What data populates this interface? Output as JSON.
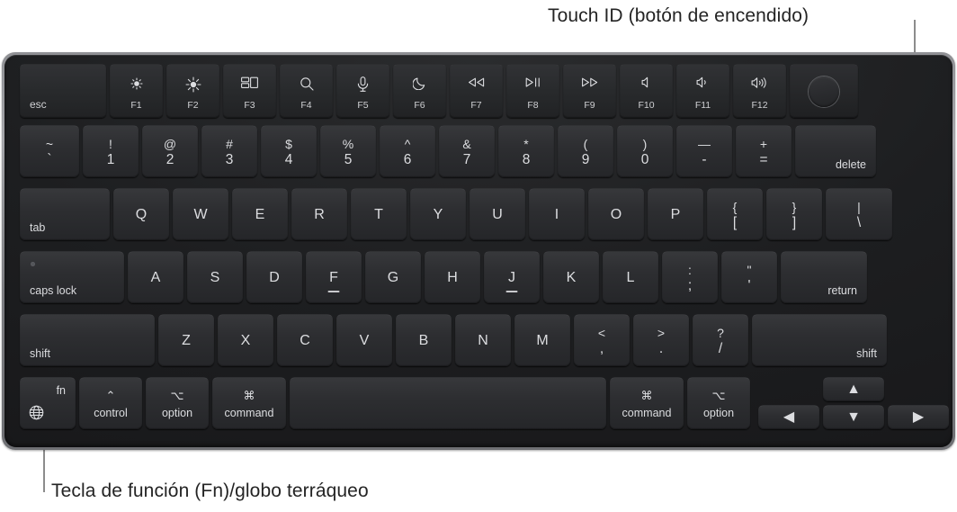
{
  "callouts": [
    {
      "id": "touch-id",
      "text": "Touch ID (botón de encendido)"
    },
    {
      "id": "fn-globe",
      "text": "Tecla de función (Fn)/globo terráqueo"
    }
  ],
  "colors": {
    "page_background": "#ffffff",
    "callout_text": "#242424",
    "leader_line": "#8c8c8c",
    "chassis": "#9a9b9f",
    "keybed": "#1d1e20",
    "key_face": "#2d2e31",
    "key_legend": "#dcdde0"
  },
  "keyboard": {
    "layout": "Apple Magic Keyboard — US ANSI with Touch ID",
    "rows": [
      {
        "name": "function-row",
        "keys": [
          {
            "name": "esc",
            "primary": "esc",
            "align": "corner-left",
            "icon": null
          },
          {
            "name": "f1",
            "fnum": "F1",
            "icon": "brightness-down-icon"
          },
          {
            "name": "f2",
            "fnum": "F2",
            "icon": "brightness-up-icon"
          },
          {
            "name": "f3",
            "fnum": "F3",
            "icon": "mission-control-icon"
          },
          {
            "name": "f4",
            "fnum": "F4",
            "icon": "spotlight-search-icon"
          },
          {
            "name": "f5",
            "fnum": "F5",
            "icon": "dictation-microphone-icon"
          },
          {
            "name": "f6",
            "fnum": "F6",
            "icon": "do-not-disturb-moon-icon"
          },
          {
            "name": "f7",
            "fnum": "F7",
            "icon": "rewind-icon"
          },
          {
            "name": "f8",
            "fnum": "F8",
            "icon": "play-pause-icon"
          },
          {
            "name": "f9",
            "fnum": "F9",
            "icon": "fast-forward-icon"
          },
          {
            "name": "f10",
            "fnum": "F10",
            "icon": "volume-mute-icon"
          },
          {
            "name": "f11",
            "fnum": "F11",
            "icon": "volume-down-icon"
          },
          {
            "name": "f12",
            "fnum": "F12",
            "icon": "volume-up-icon"
          },
          {
            "name": "touch-id",
            "fnum": "",
            "icon": "touch-id-power-button-icon"
          }
        ]
      },
      {
        "name": "number-row",
        "keys": [
          {
            "name": "grave-tilde",
            "top": "~",
            "bottom": "`"
          },
          {
            "name": "digit-1",
            "top": "!",
            "bottom": "1"
          },
          {
            "name": "digit-2",
            "top": "@",
            "bottom": "2"
          },
          {
            "name": "digit-3",
            "top": "#",
            "bottom": "3"
          },
          {
            "name": "digit-4",
            "top": "$",
            "bottom": "4"
          },
          {
            "name": "digit-5",
            "top": "%",
            "bottom": "5"
          },
          {
            "name": "digit-6",
            "top": "^",
            "bottom": "6"
          },
          {
            "name": "digit-7",
            "top": "&",
            "bottom": "7"
          },
          {
            "name": "digit-8",
            "top": "*",
            "bottom": "8"
          },
          {
            "name": "digit-9",
            "top": "(",
            "bottom": "9"
          },
          {
            "name": "digit-0",
            "top": ")",
            "bottom": "0"
          },
          {
            "name": "minus-underscore",
            "top": "—",
            "bottom": "-"
          },
          {
            "name": "equal-plus",
            "top": "+",
            "bottom": "="
          },
          {
            "name": "delete",
            "primary": "delete",
            "align": "corner-right"
          }
        ]
      },
      {
        "name": "top-letter-row",
        "keys": [
          {
            "name": "tab",
            "primary": "tab",
            "align": "corner-left"
          },
          {
            "name": "letter-q",
            "mid": "Q"
          },
          {
            "name": "letter-w",
            "mid": "W"
          },
          {
            "name": "letter-e",
            "mid": "E"
          },
          {
            "name": "letter-r",
            "mid": "R"
          },
          {
            "name": "letter-t",
            "mid": "T"
          },
          {
            "name": "letter-y",
            "mid": "Y"
          },
          {
            "name": "letter-u",
            "mid": "U"
          },
          {
            "name": "letter-i",
            "mid": "I"
          },
          {
            "name": "letter-o",
            "mid": "O"
          },
          {
            "name": "letter-p",
            "mid": "P"
          },
          {
            "name": "bracket-left",
            "top": "{",
            "bottom": "["
          },
          {
            "name": "bracket-right",
            "top": "}",
            "bottom": "]"
          },
          {
            "name": "backslash-pipe",
            "top": "|",
            "bottom": "\\"
          }
        ]
      },
      {
        "name": "home-row",
        "keys": [
          {
            "name": "caps-lock",
            "primary": "caps lock",
            "align": "corner-left",
            "led": true
          },
          {
            "name": "letter-a",
            "mid": "A"
          },
          {
            "name": "letter-s",
            "mid": "S"
          },
          {
            "name": "letter-d",
            "mid": "D"
          },
          {
            "name": "letter-f",
            "mid": "F",
            "homing": true
          },
          {
            "name": "letter-g",
            "mid": "G"
          },
          {
            "name": "letter-h",
            "mid": "H"
          },
          {
            "name": "letter-j",
            "mid": "J",
            "homing": true
          },
          {
            "name": "letter-k",
            "mid": "K"
          },
          {
            "name": "letter-l",
            "mid": "L"
          },
          {
            "name": "semicolon-colon",
            "top": ":",
            "bottom": ";"
          },
          {
            "name": "quote-doublequote",
            "top": "\"",
            "bottom": "'"
          },
          {
            "name": "return",
            "primary": "return",
            "align": "corner-right"
          }
        ]
      },
      {
        "name": "bottom-letter-row",
        "keys": [
          {
            "name": "shift-left",
            "primary": "shift",
            "align": "corner-left"
          },
          {
            "name": "letter-z",
            "mid": "Z"
          },
          {
            "name": "letter-x",
            "mid": "X"
          },
          {
            "name": "letter-c",
            "mid": "C"
          },
          {
            "name": "letter-v",
            "mid": "V"
          },
          {
            "name": "letter-b",
            "mid": "B"
          },
          {
            "name": "letter-n",
            "mid": "N"
          },
          {
            "name": "letter-m",
            "mid": "M"
          },
          {
            "name": "comma-lessthan",
            "top": "<",
            "bottom": ","
          },
          {
            "name": "period-greaterthan",
            "top": ">",
            "bottom": "."
          },
          {
            "name": "slash-question",
            "top": "?",
            "bottom": "/"
          },
          {
            "name": "shift-right",
            "primary": "shift",
            "align": "corner-right"
          }
        ]
      },
      {
        "name": "modifier-row",
        "keys": [
          {
            "name": "fn-globe",
            "corner_label": "fn",
            "icon": "globe-icon"
          },
          {
            "name": "control-left",
            "symbol": "⌃",
            "primary": "control"
          },
          {
            "name": "option-left",
            "symbol": "⌥",
            "primary": "option"
          },
          {
            "name": "command-left",
            "symbol": "⌘",
            "primary": "command"
          },
          {
            "name": "space",
            "primary": ""
          },
          {
            "name": "command-right",
            "symbol": "⌘",
            "primary": "command"
          },
          {
            "name": "option-right",
            "symbol": "⌥",
            "primary": "option"
          },
          {
            "name": "arrow-left",
            "icon": "arrow-left-icon",
            "glyph": "◀"
          },
          {
            "name": "arrow-up",
            "icon": "arrow-up-icon",
            "glyph": "▲"
          },
          {
            "name": "arrow-down",
            "icon": "arrow-down-icon",
            "glyph": "▼"
          },
          {
            "name": "arrow-right",
            "icon": "arrow-right-icon",
            "glyph": "▶"
          }
        ]
      }
    ]
  }
}
